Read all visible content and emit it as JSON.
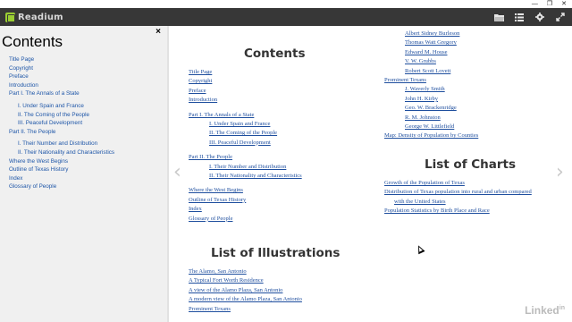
{
  "app": {
    "name": "Readium",
    "window_controls": [
      "—",
      "❐",
      "✕"
    ]
  },
  "toolbar": {
    "icons": [
      "folder-icon",
      "list-icon",
      "gear-icon",
      "fullscreen-icon"
    ]
  },
  "sidebar": {
    "title": "Contents",
    "close_label": "×",
    "items": [
      "Title Page",
      "Copyright",
      "Preface",
      "Introduction",
      "Part I. The Annals of a State",
      "I. Under Spain and France",
      "II. The Coming of the People",
      "III. Peaceful Development",
      "Part II. The People",
      "I. Their Number and Distribution",
      "II. Their Nationality and Characteristics",
      "Where the West Begins",
      "Outline of Texas History",
      "Index",
      "Glossary of People"
    ]
  },
  "page": {
    "contents_heading": "Contents",
    "contents": [
      "Title Page",
      "Copyright",
      "Preface",
      "Introduction",
      "Part I. The Annals of a State",
      "I. Under Spain and France",
      "II. The Coming of the People",
      "III. Peaceful Development",
      "Part II. The People",
      "I. Their Number and Distribution",
      "II. Their Nationality and Characteristics",
      "Where the West Begins",
      "Outline of Texas History",
      "Index",
      "Glossary of People"
    ],
    "illustrations_heading": "List of Illustrations",
    "illustrations": [
      "The Alamo, San Antonio",
      "A Typical Fort Worth Residence",
      "A view of the Alamo Plaza, San Antonio",
      "A modern view of the Alamo Plaza, San Antonio",
      "Prominent Texans"
    ],
    "right_col": {
      "people_top": [
        "Albert Sidney Burleson",
        "Thomas Watt Gregory",
        "Edward M. House",
        "V. W. Grubbs",
        "Robert Scott Lovett"
      ],
      "prominent_texans": "Prominent Texans",
      "people_bottom": [
        "J. Waverly Smith",
        "John H. Kirby",
        "Geo. W. Brackenridge",
        "R. M. Johnston",
        "George W. Littlefield"
      ],
      "map": "Map: Density of Population by Counties"
    },
    "charts_heading": "List of Charts",
    "charts": [
      "Growth of the Population of Texas",
      "Distribution of Texas population into rural and urban compared",
      "with the United States",
      "Population Statistics by Birth Place and Race"
    ]
  },
  "nav": {
    "prev": "‹",
    "next": "›"
  },
  "watermark": {
    "brand": "Linked",
    "suffix": "in"
  }
}
